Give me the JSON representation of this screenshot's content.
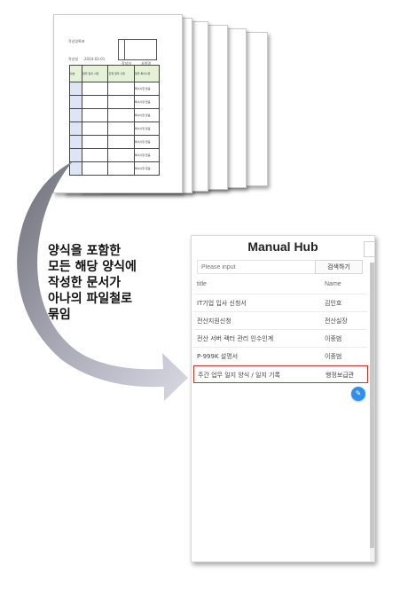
{
  "form_page": {
    "doc_title": "작성일록표",
    "meta_left": "작성일",
    "meta_mid": "2024-01-01",
    "meta_r1": "작성자",
    "meta_r2": "사원명",
    "col1": "번호",
    "col2": "업무 일지 사항",
    "col3": "진행 업무 사항",
    "col4": "업무 특이사항",
    "cell_text": "특이사항 없음"
  },
  "caption": {
    "line1": "양식을 포함한",
    "line2": "모든 해당 양식에",
    "line3": "작성한 문서가",
    "line4": "아나의 파일철로",
    "line5": "묶임"
  },
  "app": {
    "title": "Manual Hub",
    "search": {
      "placeholder": "Please input",
      "button": "검색하기"
    },
    "table": {
      "headers": {
        "title": "title",
        "name": "Name"
      },
      "rows": [
        {
          "title": "IT기업 입사 신청서",
          "name": "김인호"
        },
        {
          "title": "전산지원신청",
          "name": "전산실장"
        },
        {
          "title": "전산 서버 랙터 관리 인수인계",
          "name": "이종범"
        },
        {
          "title": "P-999K 설명서",
          "name": "이종범"
        },
        {
          "title": "주간 업무 일지 양식 / 일지 기록",
          "name": "행정보급관"
        }
      ]
    },
    "fab_icon": "edit-icon",
    "highlight_color": "#c0392b",
    "accent_color": "#2f8ff0"
  }
}
